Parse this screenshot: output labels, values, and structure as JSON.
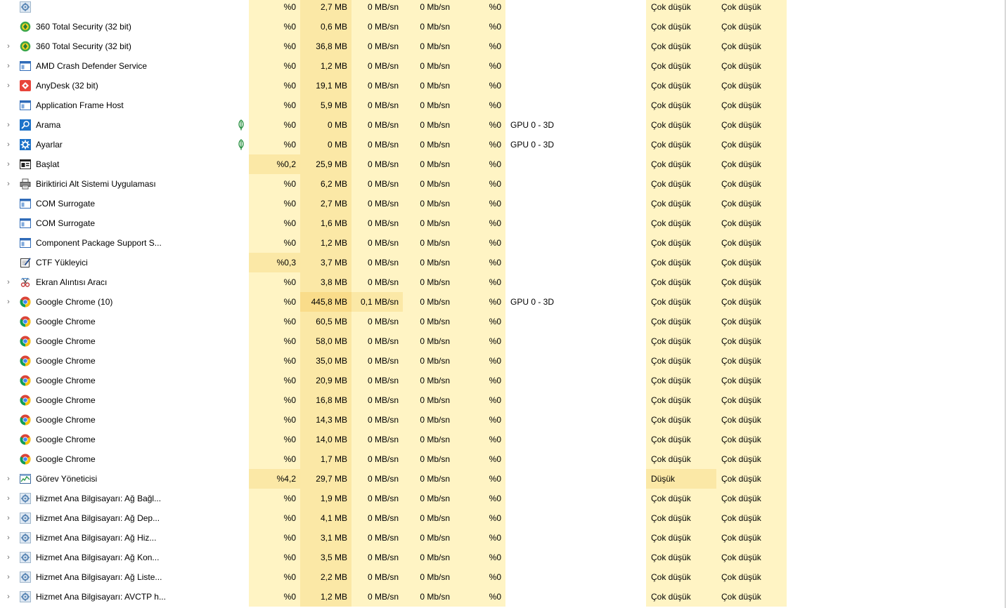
{
  "rows": [
    {
      "expand": false,
      "icon": "gear-icon",
      "name": "",
      "cpu": "%0",
      "memory": "2,7 MB",
      "disk": "0 MB/sn",
      "network": "0 Mb/sn",
      "gpu": "%0",
      "gpu_engine": "",
      "power": "Çok düşük",
      "power_trend": "Çok düşük"
    },
    {
      "expand": false,
      "icon": "shield-360-icon",
      "name": "360 Total Security (32 bit)",
      "cpu": "%0",
      "memory": "0,6 MB",
      "disk": "0 MB/sn",
      "network": "0 Mb/sn",
      "gpu": "%0",
      "gpu_engine": "",
      "power": "Çok düşük",
      "power_trend": "Çok düşük"
    },
    {
      "expand": true,
      "icon": "shield-360-icon",
      "name": "360 Total Security (32 bit)",
      "cpu": "%0",
      "memory": "36,8 MB",
      "disk": "0 MB/sn",
      "network": "0 Mb/sn",
      "gpu": "%0",
      "gpu_engine": "",
      "power": "Çok düşük",
      "power_trend": "Çok düşük"
    },
    {
      "expand": true,
      "icon": "app-window-icon",
      "name": "AMD Crash Defender Service",
      "cpu": "%0",
      "memory": "1,2 MB",
      "disk": "0 MB/sn",
      "network": "0 Mb/sn",
      "gpu": "%0",
      "gpu_engine": "",
      "power": "Çok düşük",
      "power_trend": "Çok düşük"
    },
    {
      "expand": true,
      "icon": "anydesk-icon",
      "name": "AnyDesk (32 bit)",
      "cpu": "%0",
      "memory": "19,1 MB",
      "disk": "0 MB/sn",
      "network": "0 Mb/sn",
      "gpu": "%0",
      "gpu_engine": "",
      "power": "Çok düşük",
      "power_trend": "Çok düşük"
    },
    {
      "expand": false,
      "icon": "app-window-icon",
      "name": "Application Frame Host",
      "cpu": "%0",
      "memory": "5,9 MB",
      "disk": "0 MB/sn",
      "network": "0 Mb/sn",
      "gpu": "%0",
      "gpu_engine": "",
      "power": "Çok düşük",
      "power_trend": "Çok düşük"
    },
    {
      "expand": true,
      "icon": "search-icon",
      "name": "Arama",
      "leaf": true,
      "cpu": "%0",
      "memory": "0 MB",
      "disk": "0 MB/sn",
      "network": "0 Mb/sn",
      "gpu": "%0",
      "gpu_engine": "GPU 0 - 3D",
      "power": "Çok düşük",
      "power_trend": "Çok düşük"
    },
    {
      "expand": true,
      "icon": "settings-icon",
      "name": "Ayarlar",
      "leaf": true,
      "cpu": "%0",
      "memory": "0 MB",
      "disk": "0 MB/sn",
      "network": "0 Mb/sn",
      "gpu": "%0",
      "gpu_engine": "GPU 0 - 3D",
      "power": "Çok düşük",
      "power_trend": "Çok düşük"
    },
    {
      "expand": true,
      "icon": "start-window-icon",
      "name": "Başlat",
      "cpu": "%0,2",
      "memory": "25,9 MB",
      "disk": "0 MB/sn",
      "network": "0 Mb/sn",
      "gpu": "%0",
      "gpu_engine": "",
      "power": "Çok düşük",
      "power_trend": "Çok düşük",
      "cpu_heat": 1
    },
    {
      "expand": true,
      "icon": "printer-icon",
      "name": "Biriktirici Alt Sistemi Uygulaması",
      "cpu": "%0",
      "memory": "6,2 MB",
      "disk": "0 MB/sn",
      "network": "0 Mb/sn",
      "gpu": "%0",
      "gpu_engine": "",
      "power": "Çok düşük",
      "power_trend": "Çok düşük"
    },
    {
      "expand": false,
      "icon": "app-window-icon",
      "name": "COM Surrogate",
      "cpu": "%0",
      "memory": "2,7 MB",
      "disk": "0 MB/sn",
      "network": "0 Mb/sn",
      "gpu": "%0",
      "gpu_engine": "",
      "power": "Çok düşük",
      "power_trend": "Çok düşük"
    },
    {
      "expand": false,
      "icon": "app-window-icon",
      "name": "COM Surrogate",
      "cpu": "%0",
      "memory": "1,6 MB",
      "disk": "0 MB/sn",
      "network": "0 Mb/sn",
      "gpu": "%0",
      "gpu_engine": "",
      "power": "Çok düşük",
      "power_trend": "Çok düşük"
    },
    {
      "expand": false,
      "icon": "app-window-icon",
      "name": "Component Package Support S...",
      "cpu": "%0",
      "memory": "1,2 MB",
      "disk": "0 MB/sn",
      "network": "0 Mb/sn",
      "gpu": "%0",
      "gpu_engine": "",
      "power": "Çok düşük",
      "power_trend": "Çok düşük"
    },
    {
      "expand": false,
      "icon": "ctf-loader-icon",
      "name": "CTF Yükleyici",
      "cpu": "%0,3",
      "memory": "3,7 MB",
      "disk": "0 MB/sn",
      "network": "0 Mb/sn",
      "gpu": "%0",
      "gpu_engine": "",
      "power": "Çok düşük",
      "power_trend": "Çok düşük",
      "cpu_heat": 1
    },
    {
      "expand": true,
      "icon": "snipping-tool-icon",
      "name": "Ekran Alıntısı Aracı",
      "cpu": "%0",
      "memory": "3,8 MB",
      "disk": "0 MB/sn",
      "network": "0 Mb/sn",
      "gpu": "%0",
      "gpu_engine": "",
      "power": "Çok düşük",
      "power_trend": "Çok düşük"
    },
    {
      "expand": true,
      "icon": "chrome-icon",
      "name": "Google Chrome (10)",
      "cpu": "%0",
      "memory": "445,8 MB",
      "disk": "0,1 MB/sn",
      "network": "0 Mb/sn",
      "gpu": "%0",
      "gpu_engine": "GPU 0 - 3D",
      "power": "Çok düşük",
      "power_trend": "Çok düşük",
      "mem_heat": 2,
      "disk_heat": 1
    },
    {
      "expand": false,
      "icon": "chrome-icon",
      "name": "Google Chrome",
      "cpu": "%0",
      "memory": "60,5 MB",
      "disk": "0 MB/sn",
      "network": "0 Mb/sn",
      "gpu": "%0",
      "gpu_engine": "",
      "power": "Çok düşük",
      "power_trend": "Çok düşük"
    },
    {
      "expand": false,
      "icon": "chrome-icon",
      "name": "Google Chrome",
      "cpu": "%0",
      "memory": "58,0 MB",
      "disk": "0 MB/sn",
      "network": "0 Mb/sn",
      "gpu": "%0",
      "gpu_engine": "",
      "power": "Çok düşük",
      "power_trend": "Çok düşük"
    },
    {
      "expand": false,
      "icon": "chrome-icon",
      "name": "Google Chrome",
      "cpu": "%0",
      "memory": "35,0 MB",
      "disk": "0 MB/sn",
      "network": "0 Mb/sn",
      "gpu": "%0",
      "gpu_engine": "",
      "power": "Çok düşük",
      "power_trend": "Çok düşük"
    },
    {
      "expand": false,
      "icon": "chrome-icon",
      "name": "Google Chrome",
      "cpu": "%0",
      "memory": "20,9 MB",
      "disk": "0 MB/sn",
      "network": "0 Mb/sn",
      "gpu": "%0",
      "gpu_engine": "",
      "power": "Çok düşük",
      "power_trend": "Çok düşük"
    },
    {
      "expand": false,
      "icon": "chrome-icon",
      "name": "Google Chrome",
      "cpu": "%0",
      "memory": "16,8 MB",
      "disk": "0 MB/sn",
      "network": "0 Mb/sn",
      "gpu": "%0",
      "gpu_engine": "",
      "power": "Çok düşük",
      "power_trend": "Çok düşük"
    },
    {
      "expand": false,
      "icon": "chrome-icon",
      "name": "Google Chrome",
      "cpu": "%0",
      "memory": "14,3 MB",
      "disk": "0 MB/sn",
      "network": "0 Mb/sn",
      "gpu": "%0",
      "gpu_engine": "",
      "power": "Çok düşük",
      "power_trend": "Çok düşük"
    },
    {
      "expand": false,
      "icon": "chrome-icon",
      "name": "Google Chrome",
      "cpu": "%0",
      "memory": "14,0 MB",
      "disk": "0 MB/sn",
      "network": "0 Mb/sn",
      "gpu": "%0",
      "gpu_engine": "",
      "power": "Çok düşük",
      "power_trend": "Çok düşük"
    },
    {
      "expand": false,
      "icon": "chrome-icon",
      "name": "Google Chrome",
      "cpu": "%0",
      "memory": "1,7 MB",
      "disk": "0 MB/sn",
      "network": "0 Mb/sn",
      "gpu": "%0",
      "gpu_engine": "",
      "power": "Çok düşük",
      "power_trend": "Çok düşük"
    },
    {
      "expand": true,
      "icon": "task-manager-icon",
      "name": "Görev Yöneticisi",
      "cpu": "%4,2",
      "memory": "29,7 MB",
      "disk": "0 MB/sn",
      "network": "0 Mb/sn",
      "gpu": "%0",
      "gpu_engine": "",
      "power": "Düşük",
      "power_trend": "Çok düşük",
      "cpu_heat": 1,
      "power_heat": 1
    },
    {
      "expand": true,
      "icon": "gear-icon",
      "name": "Hizmet Ana Bilgisayarı: Ağ Bağl...",
      "cpu": "%0",
      "memory": "1,9 MB",
      "disk": "0 MB/sn",
      "network": "0 Mb/sn",
      "gpu": "%0",
      "gpu_engine": "",
      "power": "Çok düşük",
      "power_trend": "Çok düşük"
    },
    {
      "expand": true,
      "icon": "gear-icon",
      "name": "Hizmet Ana Bilgisayarı: Ağ Dep...",
      "cpu": "%0",
      "memory": "4,1 MB",
      "disk": "0 MB/sn",
      "network": "0 Mb/sn",
      "gpu": "%0",
      "gpu_engine": "",
      "power": "Çok düşük",
      "power_trend": "Çok düşük"
    },
    {
      "expand": true,
      "icon": "gear-icon",
      "name": "Hizmet Ana Bilgisayarı: Ağ Hiz...",
      "cpu": "%0",
      "memory": "3,1 MB",
      "disk": "0 MB/sn",
      "network": "0 Mb/sn",
      "gpu": "%0",
      "gpu_engine": "",
      "power": "Çok düşük",
      "power_trend": "Çok düşük"
    },
    {
      "expand": true,
      "icon": "gear-icon",
      "name": "Hizmet Ana Bilgisayarı: Ağ Kon...",
      "cpu": "%0",
      "memory": "3,5 MB",
      "disk": "0 MB/sn",
      "network": "0 Mb/sn",
      "gpu": "%0",
      "gpu_engine": "",
      "power": "Çok düşük",
      "power_trend": "Çok düşük"
    },
    {
      "expand": true,
      "icon": "gear-icon",
      "name": "Hizmet Ana Bilgisayarı: Ağ Liste...",
      "cpu": "%0",
      "memory": "2,2 MB",
      "disk": "0 MB/sn",
      "network": "0 Mb/sn",
      "gpu": "%0",
      "gpu_engine": "",
      "power": "Çok düşük",
      "power_trend": "Çok düşük"
    },
    {
      "expand": true,
      "icon": "gear-icon",
      "name": "Hizmet Ana Bilgisayarı: AVCTP h...",
      "cpu": "%0",
      "memory": "1,2 MB",
      "disk": "0 MB/sn",
      "network": "0 Mb/sn",
      "gpu": "%0",
      "gpu_engine": "",
      "power": "Çok düşük",
      "power_trend": "Çok düşük"
    }
  ]
}
